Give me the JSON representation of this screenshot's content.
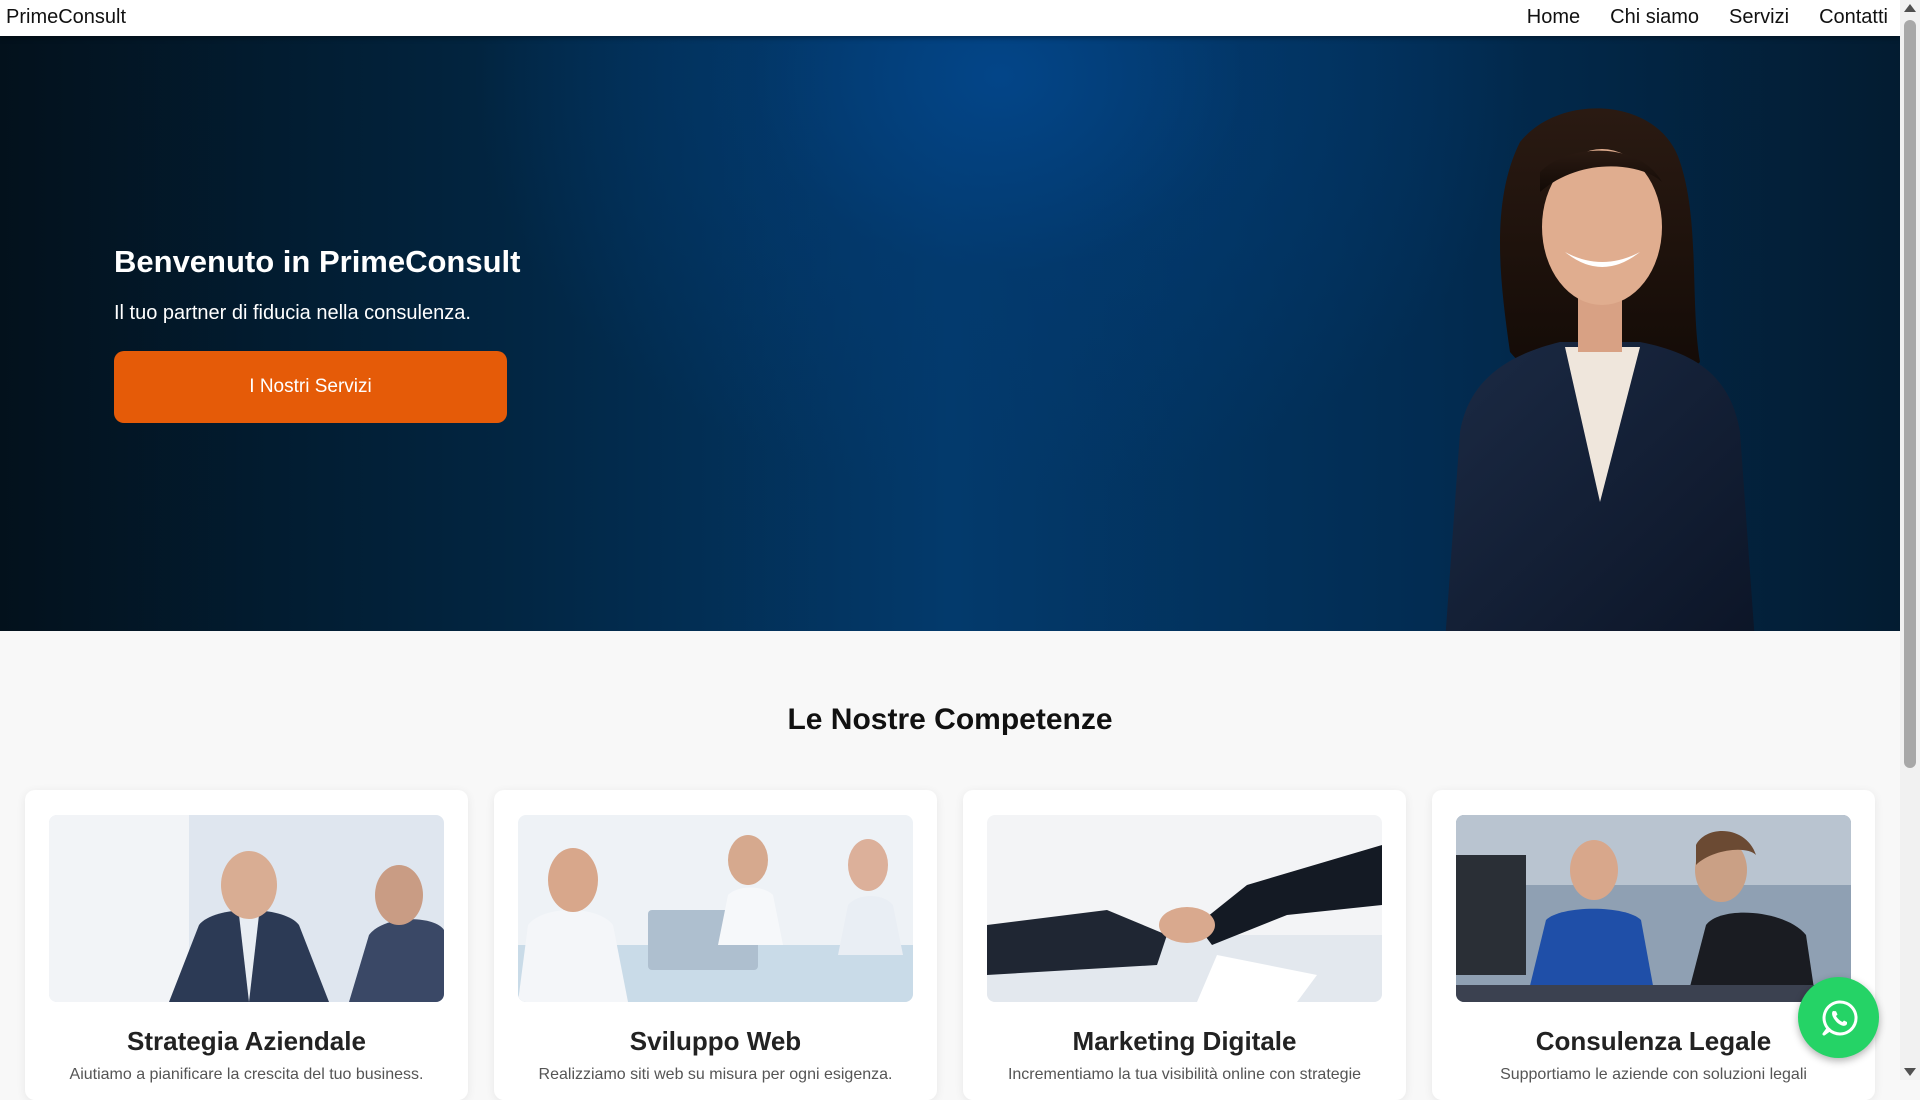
{
  "navbar": {
    "brand": "PrimeConsult",
    "links": [
      "Home",
      "Chi siamo",
      "Servizi",
      "Contatti"
    ]
  },
  "hero": {
    "title": "Benvenuto in PrimeConsult",
    "subtitle": "Il tuo partner di fiducia nella consulenza.",
    "cta": "I Nostri Servizi"
  },
  "services": {
    "title": "Le Nostre Competenze",
    "cards": [
      {
        "title": "Strategia Aziendale",
        "description": "Aiutiamo a pianificare la crescita del tuo business."
      },
      {
        "title": "Sviluppo Web",
        "description": "Realizziamo siti web su misura per ogni esigenza."
      },
      {
        "title": "Marketing Digitale",
        "description": "Incrementiamo la tua visibilità online con strategie"
      },
      {
        "title": "Consulenza Legale",
        "description": "Supportiamo le aziende con soluzioni legali"
      }
    ]
  },
  "colors": {
    "accent": "#e55b08",
    "hero_bg": "#033a6c",
    "whatsapp": "#25d366"
  },
  "icons": [
    "whatsapp-icon",
    "scroll-up-arrow-icon",
    "scroll-down-arrow-icon"
  ]
}
